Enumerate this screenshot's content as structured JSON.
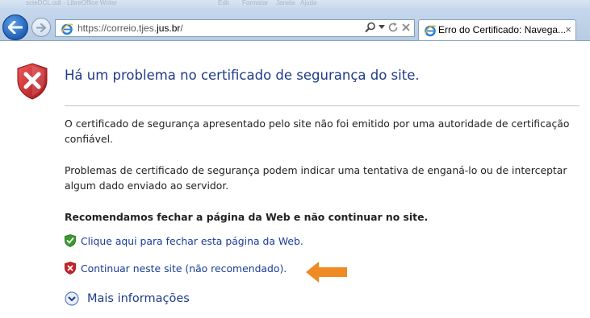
{
  "window": {
    "faded_title_items": [
      "scteDCL.odt - LibreOffice Writer",
      "Edit",
      "Formatar",
      "Janela",
      "Ajuda"
    ]
  },
  "browser": {
    "address": {
      "prefix": "https://",
      "pre_domain": "correio.tjes.",
      "domain": "jus.br",
      "path": "/"
    },
    "tab": {
      "title": "Erro do Certificado: Navega...",
      "close": "×"
    },
    "icons": {
      "back": "back-arrow-icon",
      "forward": "forward-arrow-icon",
      "search": "search-icon",
      "dropdown": "dropdown-icon",
      "refresh": "refresh-icon",
      "favicon": "ie-favicon-icon"
    }
  },
  "page": {
    "title": "Há um problema no certificado de segurança do site.",
    "paragraph1": "O certificado de segurança apresentado pelo site não foi emitido por uma autoridade de certificação confiável.",
    "paragraph2": "Problemas de certificado de segurança podem indicar uma tentativa de enganá-lo ou de interceptar algum dado enviado ao servidor.",
    "recommendation": "Recomendamos fechar a página da Web e não continuar no site.",
    "link_close": "Clique aqui para fechar esta página da Web.",
    "link_continue": "Continuar neste site (não recomendado).",
    "more_info": "Mais informações",
    "colors": {
      "title": "#1f3b8a",
      "link": "#1a3c9a",
      "error_red": "#c8232a",
      "safe_green": "#3a9a2e",
      "arrow_orange": "#f08a24"
    }
  }
}
